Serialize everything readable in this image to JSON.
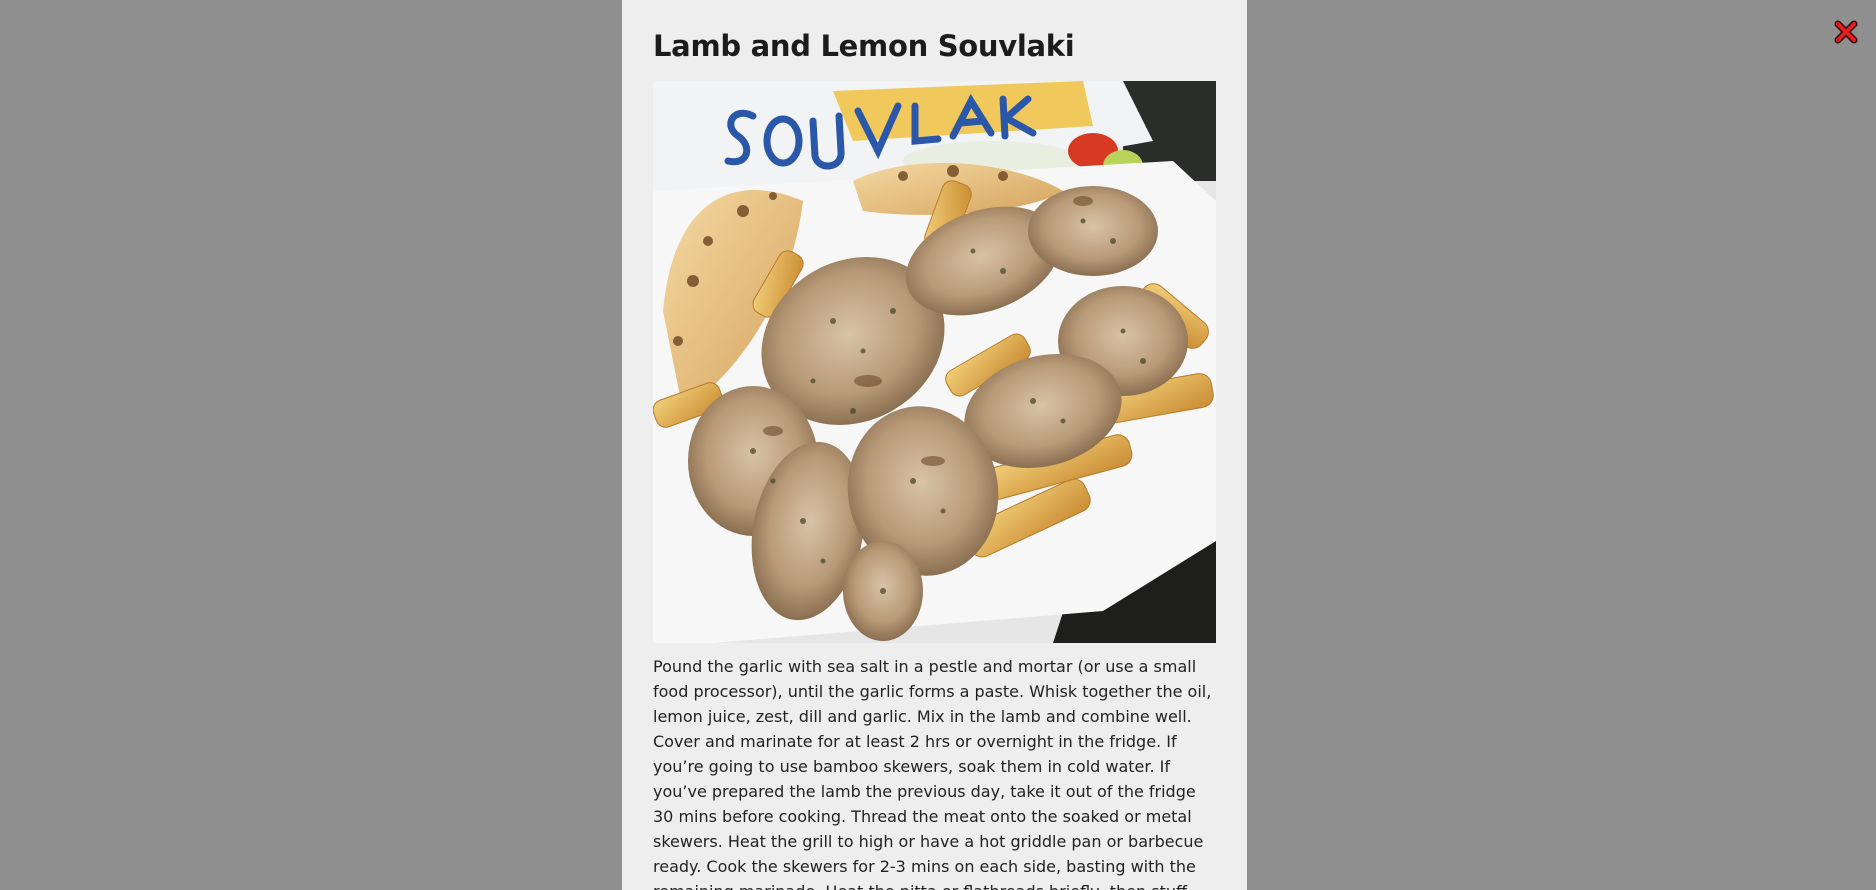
{
  "modal": {
    "title": "Lamb and Lemon Souvlaki",
    "image": {
      "icon": "souvlaki-photo",
      "bag_text": "SOUVLAKI"
    },
    "description": "Pound the garlic with sea salt in a pestle and mortar (or use a small food processor), until the garlic forms a paste. Whisk together the oil, lemon juice, zest, dill and garlic. Mix in the lamb and combine well. Cover and marinate for at least 2 hrs or overnight in the fridge. If you’re going to use bamboo skewers, soak them in cold water. If you’ve prepared the lamb the previous day, take it out of the fridge 30 mins before cooking. Thread the meat onto the soaked or metal skewers. Heat the grill to high or have a hot griddle pan or barbecue ready. Cook the skewers for 2-3 mins on each side, basting with the remaining marinade. Heat the pitta or flatbreads briefly, then stuff with the souvlaki."
  },
  "close": {
    "icon": "close-icon",
    "color": "#e02020"
  },
  "colors": {
    "overlay": "#8f8f8f",
    "modal_bg": "#eeeeee",
    "title": "#1c1c1c",
    "text": "#222222"
  }
}
